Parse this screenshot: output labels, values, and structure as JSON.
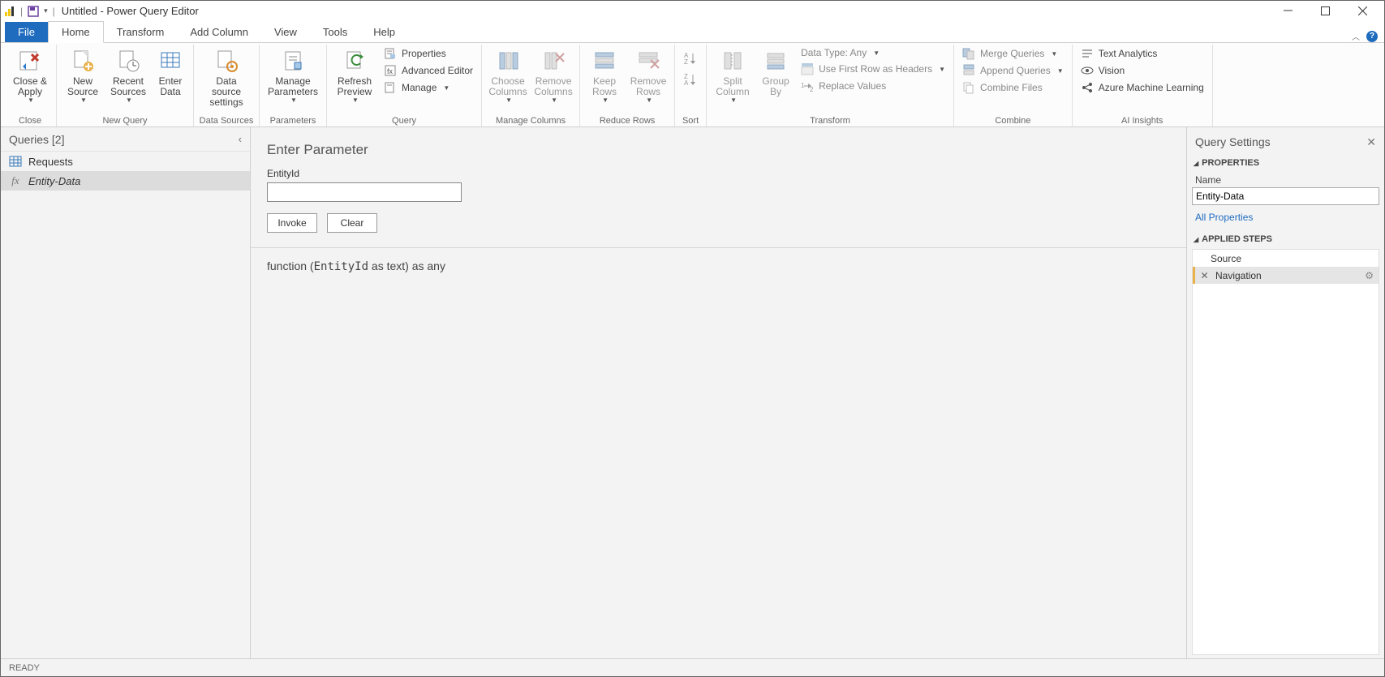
{
  "window": {
    "title": "Untitled - Power Query Editor"
  },
  "tabs": {
    "file": "File",
    "home": "Home",
    "transform": "Transform",
    "addcolumn": "Add Column",
    "view": "View",
    "tools": "Tools",
    "help": "Help"
  },
  "ribbon": {
    "close_apply": "Close &\nApply",
    "close_group": "Close",
    "new_source": "New\nSource",
    "recent_sources": "Recent\nSources",
    "enter_data": "Enter\nData",
    "new_query_group": "New Query",
    "data_source": "Data source\nsettings",
    "data_sources_group": "Data Sources",
    "manage_params": "Manage\nParameters",
    "parameters_group": "Parameters",
    "refresh": "Refresh\nPreview",
    "properties": "Properties",
    "adv_editor": "Advanced Editor",
    "manage": "Manage",
    "query_group": "Query",
    "choose_cols": "Choose\nColumns",
    "remove_cols": "Remove\nColumns",
    "manage_cols_group": "Manage Columns",
    "keep_rows": "Keep\nRows",
    "remove_rows": "Remove\nRows",
    "reduce_rows_group": "Reduce Rows",
    "sort_group": "Sort",
    "split_col": "Split\nColumn",
    "group_by": "Group\nBy",
    "data_type": "Data Type: Any",
    "first_row": "Use First Row as Headers",
    "replace_vals": "Replace Values",
    "transform_group": "Transform",
    "merge_q": "Merge Queries",
    "append_q": "Append Queries",
    "combine_files": "Combine Files",
    "combine_group": "Combine",
    "text_analytics": "Text Analytics",
    "vision": "Vision",
    "azure_ml": "Azure Machine Learning",
    "ai_group": "AI Insights"
  },
  "queries": {
    "header": "Queries [2]",
    "items": [
      {
        "name": "Requests",
        "type": "table"
      },
      {
        "name": "Entity-Data",
        "type": "fx"
      }
    ]
  },
  "main": {
    "title": "Enter Parameter",
    "param_label": "EntityId",
    "invoke": "Invoke",
    "clear": "Clear",
    "sig_pre": "function (",
    "sig_param": "EntityId",
    "sig_post": " as text) as any"
  },
  "settings": {
    "header": "Query Settings",
    "properties": "PROPERTIES",
    "name_label": "Name",
    "name_value": "Entity-Data",
    "all_properties": "All Properties",
    "applied_steps": "APPLIED STEPS",
    "steps": [
      {
        "name": "Source"
      },
      {
        "name": "Navigation"
      }
    ]
  },
  "status": "READY"
}
